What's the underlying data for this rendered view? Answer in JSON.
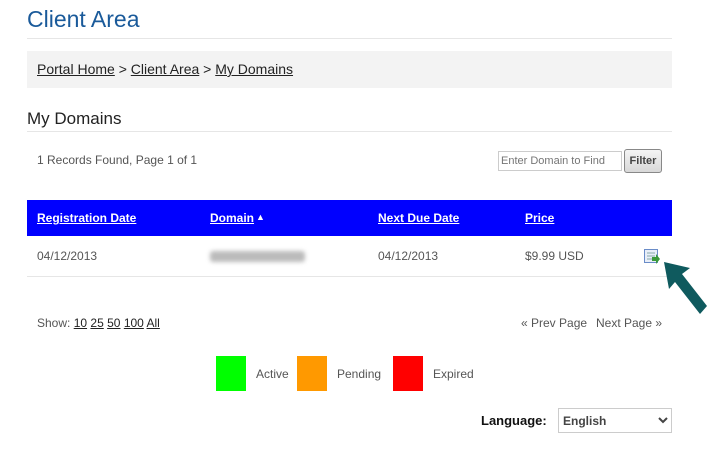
{
  "header": {
    "title": "Client Area"
  },
  "breadcrumb": {
    "items": [
      "Portal Home",
      "Client Area",
      "My Domains"
    ],
    "sep": ">"
  },
  "section": {
    "title": "My Domains",
    "records": "1 Records Found, Page 1 of 1"
  },
  "filter": {
    "placeholder": "Enter Domain to Find",
    "button": "Filter"
  },
  "table": {
    "columns": [
      "Registration Date",
      "Domain",
      "Next Due Date",
      "Price"
    ],
    "sort_icon": "▲",
    "rows": [
      {
        "registration_date": "04/12/2013",
        "next_due_date": "04/12/2013",
        "price": "$9.99 USD",
        "action_icon": "manage-domain-icon"
      }
    ]
  },
  "pagination": {
    "show_label": "Show:",
    "sizes": [
      "10",
      "25",
      "50",
      "100",
      "All"
    ],
    "prev": "« Prev Page",
    "next": "Next Page »"
  },
  "legend": [
    {
      "label": "Active",
      "color": "#00ff00"
    },
    {
      "label": "Pending",
      "color": "#ff9900"
    },
    {
      "label": "Expired",
      "color": "#ff0000"
    }
  ],
  "language": {
    "label": "Language:",
    "selected": "English"
  },
  "colors": {
    "header_bg": "#0000ff",
    "title": "#1a5a9a",
    "arrow": "#0f5a5e"
  }
}
